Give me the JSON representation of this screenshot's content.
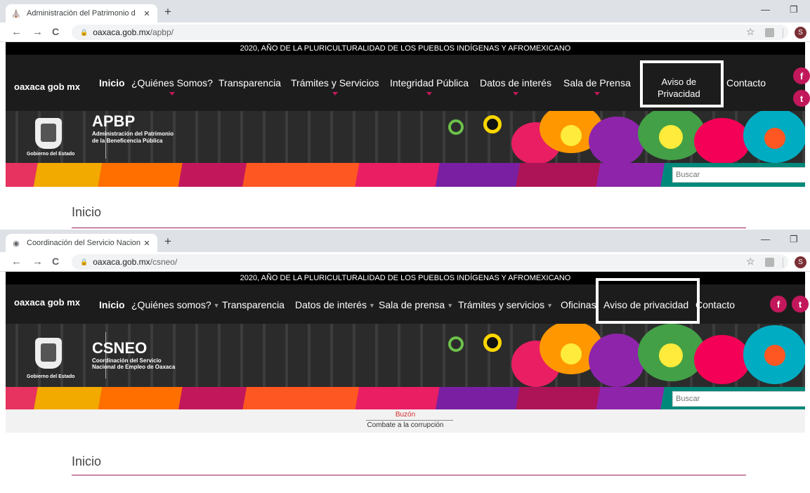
{
  "windows": [
    {
      "tab_title": "Administración del Patrimonio d",
      "url_host": "oaxaca.gob.mx",
      "url_path": "/apbp/",
      "announcement": "2020, AÑO DE LA PLURICULTURALIDAD DE LOS PUEBLOS INDÍGENAS Y AFROMEXICANO",
      "brand": "oaxaca gob mx",
      "menu": {
        "inicio": "Inicio",
        "quienes": "¿Quiénes Somos?",
        "transparencia": "Transparencia",
        "tramites": "Trámites y Servicios",
        "integridad": "Integridad Pública",
        "datos": "Datos de interés",
        "sala": "Sala de Prensa",
        "aviso_line1": "Aviso de",
        "aviso_line2": "Privacidad",
        "contacto": "Contacto"
      },
      "acronym": "APBP",
      "agency_line1": "Administración del Patrimonio",
      "agency_line2": "de la Beneficencia Pública",
      "gobierno": "Gobierno del Estado",
      "search_placeholder": "Buscar",
      "breadcrumb": "Inicio"
    },
    {
      "tab_title": "Coordinación del Servicio Nacion",
      "url_host": "oaxaca.gob.mx",
      "url_path": "/csneo/",
      "announcement": "2020, AÑO DE LA PLURICULTURALIDAD DE LOS PUEBLOS INDÍGENAS Y AFROMEXICANO",
      "brand": "oaxaca gob mx",
      "menu": {
        "inicio": "Inicio",
        "quienes": "¿Quiénes somos?",
        "transparencia": "Transparencia",
        "datos": "Datos de interés",
        "sala": "Sala de prensa",
        "tramites": "Trámites y servicios",
        "oficinas": "Oficinas",
        "aviso": "Aviso de privacidad",
        "contacto": "Contacto"
      },
      "acronym": "CSNEO",
      "agency_line1": "Coordinación del Servicio",
      "agency_line2": "Nacional de Empleo de Oaxaca",
      "gobierno": "Gobierno del Estado",
      "search_placeholder": "Buscar",
      "buzon": "Buzón",
      "combate": "Combate a la corrupción",
      "breadcrumb": "Inicio"
    }
  ],
  "icons": {
    "favicon1": "⛪",
    "favicon2": "◉",
    "close": "✕",
    "newtab": "+",
    "minimize": "—",
    "restore": "❐",
    "back": "←",
    "forward": "→",
    "reload": "C",
    "lock": "🔒",
    "star": "☆",
    "profile": "S",
    "facebook": "f",
    "twitter": "t"
  },
  "colors": {
    "accent": "#c2185b",
    "nav_bg": "#1c1c1c",
    "highlight_box": "#ffffff"
  }
}
